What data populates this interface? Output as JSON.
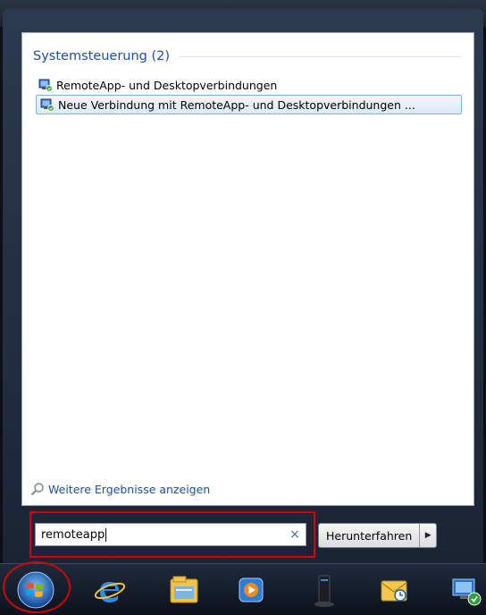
{
  "start_menu": {
    "group_title": "Systemsteuerung (2)",
    "results": [
      {
        "label": "RemoteApp- und Desktopverbindungen",
        "icon": "remote-desktop-icon"
      },
      {
        "label": "Neue Verbindung mit RemoteApp- und Desktopverbindungen ...",
        "icon": "remote-desktop-icon",
        "selected": true
      }
    ],
    "more_results_label": "Weitere Ergebnisse anzeigen",
    "search": {
      "value": "remoteapp",
      "clear_glyph": "×"
    },
    "shutdown_label": "Herunterfahren",
    "shutdown_arrow_glyph": "▶"
  },
  "taskbar": {
    "items": [
      "windows-start-orb-icon",
      "internet-explorer-icon",
      "file-explorer-icon",
      "media-player-icon",
      "server-icon",
      "outlook-icon",
      "remote-desktop-icon"
    ]
  },
  "colors": {
    "accent": "#1e4fa5",
    "highlight_outline": "#d40000"
  }
}
